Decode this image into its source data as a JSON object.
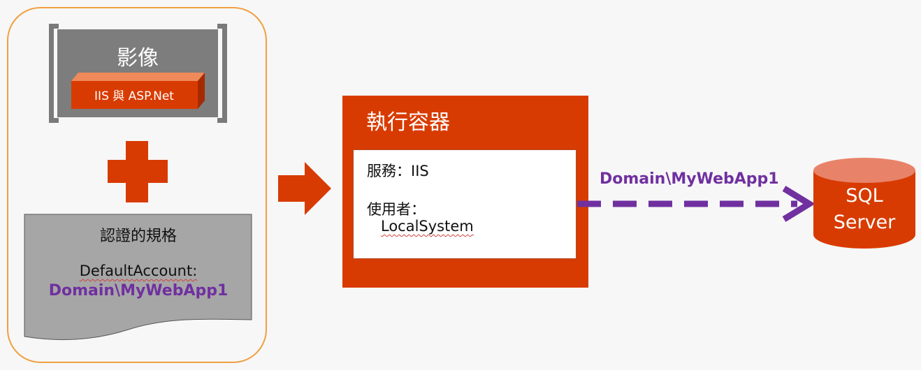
{
  "image_box": {
    "title": "影像",
    "component_label": "IIS 與 ASP.Net"
  },
  "credential_spec": {
    "title": "認證的規格",
    "account_label": "DefaultAccount:",
    "account_value": "Domain\\MyWebApp1"
  },
  "container": {
    "title": "執行容器",
    "service_line": "服務：IIS",
    "user_label": "使用者：",
    "user_value": "LocalSystem"
  },
  "connection": {
    "label": "Domain\\MyWebApp1"
  },
  "database": {
    "line1": "SQL",
    "line2": "Server"
  },
  "colors": {
    "accent_orange": "#d83b01",
    "frame_orange": "#f0a040",
    "purple": "#7030a0",
    "gray": "#7d7d7d",
    "doc_gray": "#a6a6a6"
  }
}
